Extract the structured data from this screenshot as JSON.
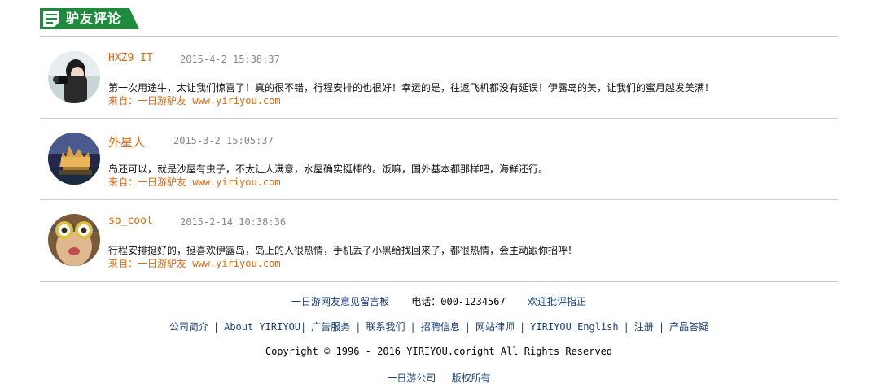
{
  "section": {
    "title": "驴友评论"
  },
  "comments": [
    {
      "name": "HXZ9_IT",
      "time": "2015-4-2 15:38:37",
      "text": "第一次用途牛，太让我们惊喜了！真的很不错，行程安排的也很好！幸运的是，往返飞机都没有延误！伊露岛的美，让我们的蜜月越发美满！",
      "source": "来自：一日游驴友 www.yiriyou.com"
    },
    {
      "name": "外星人",
      "time": "2015-3-2 15:05:37",
      "text": "岛还可以，就是沙屋有虫子，不太让人满意，水屋确实挺棒的。饭嘛，国外基本都那样吧，海鲜还行。",
      "source": "来自：一日游驴友 www.yiriyou.com"
    },
    {
      "name": "so_cool",
      "time": "2015-2-14 10:38:36",
      "text": "行程安排挺好的，挺喜欢伊露岛，岛上的人很热情，手机丢了小黑给找回来了，都很热情，会主动跟你招呼！",
      "source": "来自：一日游驴友 www.yiriyou.com"
    }
  ],
  "footer": {
    "line1": [
      "一日游网友意见留言板",
      "电话：000-1234567",
      "欢迎批评指正"
    ],
    "links": [
      "公司简介",
      "About YIRIYOU",
      "广告服务",
      "联系我们",
      "招聘信息",
      "网站律师",
      "YIRIYOU English",
      "注册",
      "产品答疑"
    ],
    "copyright": "Copyright © 1996 - 2016 YIRIYOU.coright All Rights Reserved",
    "company": [
      "一日游公司",
      "版权所有"
    ]
  }
}
